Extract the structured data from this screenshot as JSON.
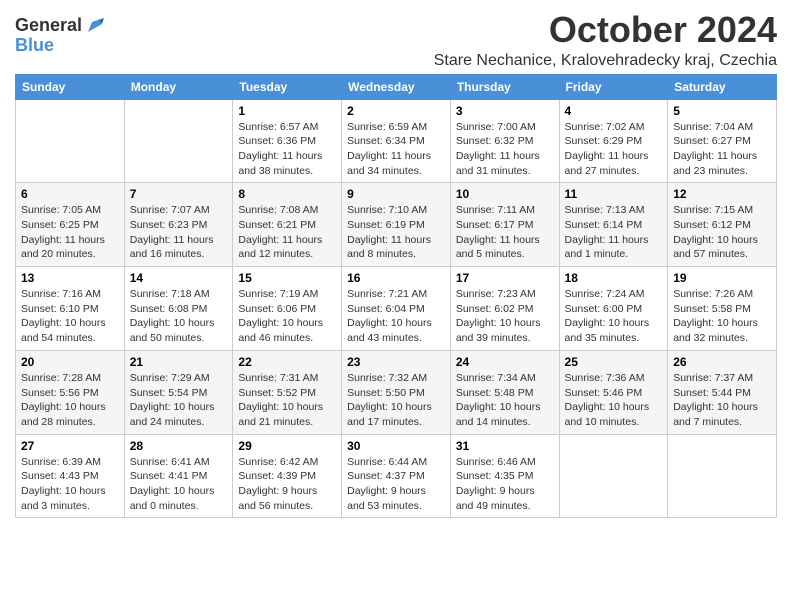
{
  "header": {
    "logo_general": "General",
    "logo_blue": "Blue",
    "month_title": "October 2024",
    "location": "Stare Nechanice, Kralovehradecky kraj, Czechia"
  },
  "days_of_week": [
    "Sunday",
    "Monday",
    "Tuesday",
    "Wednesday",
    "Thursday",
    "Friday",
    "Saturday"
  ],
  "weeks": [
    [
      {
        "day": "",
        "info": ""
      },
      {
        "day": "",
        "info": ""
      },
      {
        "day": "1",
        "info": "Sunrise: 6:57 AM\nSunset: 6:36 PM\nDaylight: 11 hours and 38 minutes."
      },
      {
        "day": "2",
        "info": "Sunrise: 6:59 AM\nSunset: 6:34 PM\nDaylight: 11 hours and 34 minutes."
      },
      {
        "day": "3",
        "info": "Sunrise: 7:00 AM\nSunset: 6:32 PM\nDaylight: 11 hours and 31 minutes."
      },
      {
        "day": "4",
        "info": "Sunrise: 7:02 AM\nSunset: 6:29 PM\nDaylight: 11 hours and 27 minutes."
      },
      {
        "day": "5",
        "info": "Sunrise: 7:04 AM\nSunset: 6:27 PM\nDaylight: 11 hours and 23 minutes."
      }
    ],
    [
      {
        "day": "6",
        "info": "Sunrise: 7:05 AM\nSunset: 6:25 PM\nDaylight: 11 hours and 20 minutes."
      },
      {
        "day": "7",
        "info": "Sunrise: 7:07 AM\nSunset: 6:23 PM\nDaylight: 11 hours and 16 minutes."
      },
      {
        "day": "8",
        "info": "Sunrise: 7:08 AM\nSunset: 6:21 PM\nDaylight: 11 hours and 12 minutes."
      },
      {
        "day": "9",
        "info": "Sunrise: 7:10 AM\nSunset: 6:19 PM\nDaylight: 11 hours and 8 minutes."
      },
      {
        "day": "10",
        "info": "Sunrise: 7:11 AM\nSunset: 6:17 PM\nDaylight: 11 hours and 5 minutes."
      },
      {
        "day": "11",
        "info": "Sunrise: 7:13 AM\nSunset: 6:14 PM\nDaylight: 11 hours and 1 minute."
      },
      {
        "day": "12",
        "info": "Sunrise: 7:15 AM\nSunset: 6:12 PM\nDaylight: 10 hours and 57 minutes."
      }
    ],
    [
      {
        "day": "13",
        "info": "Sunrise: 7:16 AM\nSunset: 6:10 PM\nDaylight: 10 hours and 54 minutes."
      },
      {
        "day": "14",
        "info": "Sunrise: 7:18 AM\nSunset: 6:08 PM\nDaylight: 10 hours and 50 minutes."
      },
      {
        "day": "15",
        "info": "Sunrise: 7:19 AM\nSunset: 6:06 PM\nDaylight: 10 hours and 46 minutes."
      },
      {
        "day": "16",
        "info": "Sunrise: 7:21 AM\nSunset: 6:04 PM\nDaylight: 10 hours and 43 minutes."
      },
      {
        "day": "17",
        "info": "Sunrise: 7:23 AM\nSunset: 6:02 PM\nDaylight: 10 hours and 39 minutes."
      },
      {
        "day": "18",
        "info": "Sunrise: 7:24 AM\nSunset: 6:00 PM\nDaylight: 10 hours and 35 minutes."
      },
      {
        "day": "19",
        "info": "Sunrise: 7:26 AM\nSunset: 5:58 PM\nDaylight: 10 hours and 32 minutes."
      }
    ],
    [
      {
        "day": "20",
        "info": "Sunrise: 7:28 AM\nSunset: 5:56 PM\nDaylight: 10 hours and 28 minutes."
      },
      {
        "day": "21",
        "info": "Sunrise: 7:29 AM\nSunset: 5:54 PM\nDaylight: 10 hours and 24 minutes."
      },
      {
        "day": "22",
        "info": "Sunrise: 7:31 AM\nSunset: 5:52 PM\nDaylight: 10 hours and 21 minutes."
      },
      {
        "day": "23",
        "info": "Sunrise: 7:32 AM\nSunset: 5:50 PM\nDaylight: 10 hours and 17 minutes."
      },
      {
        "day": "24",
        "info": "Sunrise: 7:34 AM\nSunset: 5:48 PM\nDaylight: 10 hours and 14 minutes."
      },
      {
        "day": "25",
        "info": "Sunrise: 7:36 AM\nSunset: 5:46 PM\nDaylight: 10 hours and 10 minutes."
      },
      {
        "day": "26",
        "info": "Sunrise: 7:37 AM\nSunset: 5:44 PM\nDaylight: 10 hours and 7 minutes."
      }
    ],
    [
      {
        "day": "27",
        "info": "Sunrise: 6:39 AM\nSunset: 4:43 PM\nDaylight: 10 hours and 3 minutes."
      },
      {
        "day": "28",
        "info": "Sunrise: 6:41 AM\nSunset: 4:41 PM\nDaylight: 10 hours and 0 minutes."
      },
      {
        "day": "29",
        "info": "Sunrise: 6:42 AM\nSunset: 4:39 PM\nDaylight: 9 hours and 56 minutes."
      },
      {
        "day": "30",
        "info": "Sunrise: 6:44 AM\nSunset: 4:37 PM\nDaylight: 9 hours and 53 minutes."
      },
      {
        "day": "31",
        "info": "Sunrise: 6:46 AM\nSunset: 4:35 PM\nDaylight: 9 hours and 49 minutes."
      },
      {
        "day": "",
        "info": ""
      },
      {
        "day": "",
        "info": ""
      }
    ]
  ]
}
